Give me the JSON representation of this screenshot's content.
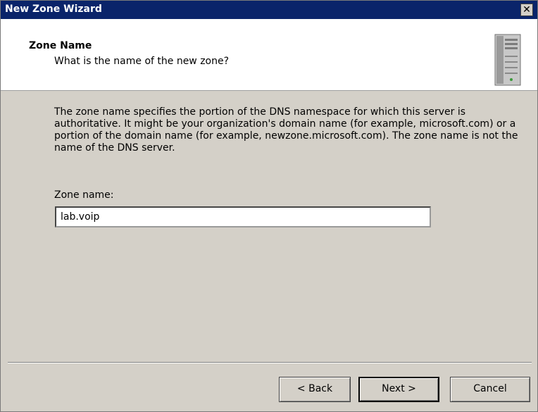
{
  "window": {
    "title": "New Zone Wizard",
    "close_glyph": "✕"
  },
  "header": {
    "title": "Zone Name",
    "subtitle": "What is the name of the new zone?",
    "icon": "server-icon"
  },
  "main": {
    "description": "The zone name specifies the portion of the DNS namespace for which this server is authoritative. It might be your organization's domain name (for example,  microsoft.com) or a portion of the domain name (for example, newzone.microsoft.com). The zone name is not the name of the DNS server.",
    "zone_name_label": "Zone name:",
    "zone_name_value": "lab.voip"
  },
  "footer": {
    "back_label": "< Back",
    "next_label": "Next >",
    "cancel_label": "Cancel"
  }
}
